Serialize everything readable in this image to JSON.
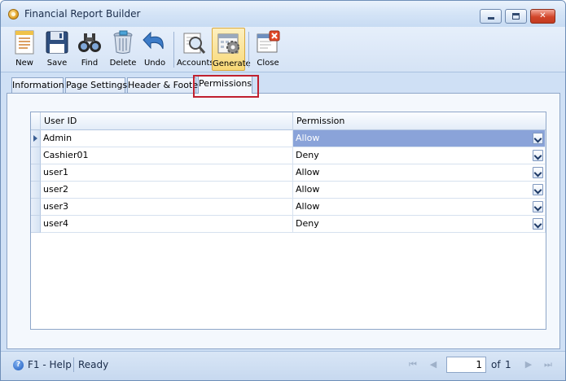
{
  "window": {
    "title": "Financial Report Builder"
  },
  "toolbar": {
    "buttons": [
      {
        "id": "new",
        "label": "New",
        "icon": "new-document-icon"
      },
      {
        "id": "save",
        "label": "Save",
        "icon": "floppy-disk-icon"
      },
      {
        "id": "find",
        "label": "Find",
        "icon": "binoculars-icon"
      },
      {
        "id": "delete",
        "label": "Delete",
        "icon": "trash-can-icon"
      },
      {
        "id": "undo",
        "label": "Undo",
        "icon": "undo-arrow-icon"
      },
      {
        "id": "accounts",
        "label": "Accounts",
        "icon": "accounts-magnifier-icon"
      },
      {
        "id": "generate",
        "label": "Generate",
        "icon": "generate-calendar-gear-icon",
        "active": true
      },
      {
        "id": "close",
        "label": "Close",
        "icon": "close-window-icon"
      }
    ]
  },
  "tabs": [
    {
      "label": "Information"
    },
    {
      "label": "Page Settings"
    },
    {
      "label": "Header & Footer"
    },
    {
      "label": "Permissions",
      "selected": true
    }
  ],
  "grid": {
    "columns": [
      "User ID",
      "Permission"
    ],
    "rows": [
      {
        "user_id": "Admin",
        "permission": "Allow",
        "selected": true
      },
      {
        "user_id": "Cashier01",
        "permission": "Deny"
      },
      {
        "user_id": "user1",
        "permission": "Allow"
      },
      {
        "user_id": "user2",
        "permission": "Allow"
      },
      {
        "user_id": "user3",
        "permission": "Allow"
      },
      {
        "user_id": "user4",
        "permission": "Deny"
      }
    ]
  },
  "statusbar": {
    "help": "F1 - Help",
    "status": "Ready",
    "page": "1",
    "of_label": "of",
    "total_pages": "1"
  },
  "colors": {
    "highlight_box": "#c0202e",
    "selected_cell": "#8aa3d9",
    "active_button": "#f8d876"
  }
}
